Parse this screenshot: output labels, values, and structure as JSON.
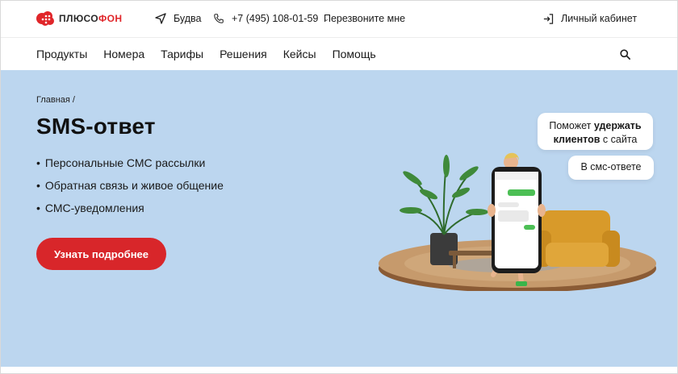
{
  "brand": {
    "name_part1": "ПЛЮСО",
    "name_part2": "ФОН",
    "accent": "#e0262a"
  },
  "header": {
    "city": "Будва",
    "phone": "+7 (495) 108-01-59",
    "callback": "Перезвоните мне",
    "cabinet": "Личный кабинет"
  },
  "nav": {
    "items": [
      "Продукты",
      "Номера",
      "Тарифы",
      "Решения",
      "Кейсы",
      "Помощь"
    ]
  },
  "hero": {
    "breadcrumb": "Главная /",
    "title": "SMS-ответ",
    "bullets": [
      "Персональные СМС рассылки",
      "Обратная связь и живое общение",
      "СМС-уведомления"
    ],
    "cta": "Узнать подробнее",
    "bubble1": {
      "pre": "Поможет ",
      "bold1": "удержать",
      "bold2": "клиентов",
      "post": " с сайта"
    },
    "bubble2": "В смс-ответе",
    "background": "#bcd6ef",
    "cta_color": "#d8262a"
  },
  "icons": {
    "location": "navigation-arrow-icon",
    "phone": "phone-icon",
    "login": "login-icon",
    "search": "search-icon"
  }
}
